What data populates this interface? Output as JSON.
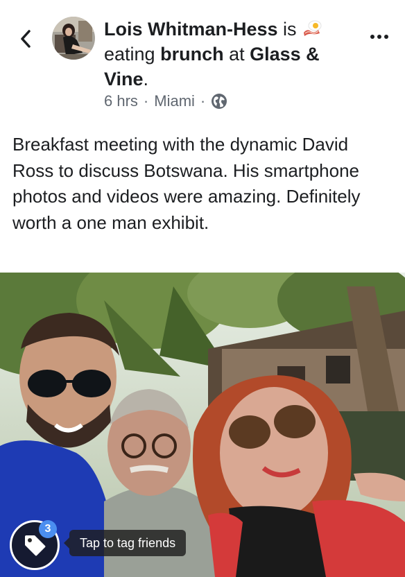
{
  "post": {
    "author": "Lois Whitman-Hess",
    "connector_is": " is ",
    "activity_prefix": "eating ",
    "activity": "brunch",
    "connector_at": " at ",
    "place": "Glass & Vine",
    "end_period": ".",
    "time": "6 hrs",
    "separator": "·",
    "location": "Miami",
    "privacy_icon": "globe-icon",
    "body": "Breakfast meeting with the dynamic David Ross to discuss Botswana. His smartphone photos and videos were amazing. Definitely worth a one man exhibit."
  },
  "header": {
    "back_icon": "chevron-left-icon",
    "more_icon": "more-options-icon",
    "activity_icon": "bacon-egg-icon"
  },
  "photo": {
    "tag_count": "3",
    "tag_hint": "Tap to tag friends",
    "tag_icon": "tag-icon"
  },
  "colors": {
    "text": "#1c1e21",
    "meta": "#606770",
    "badge": "#4b8ef0"
  }
}
